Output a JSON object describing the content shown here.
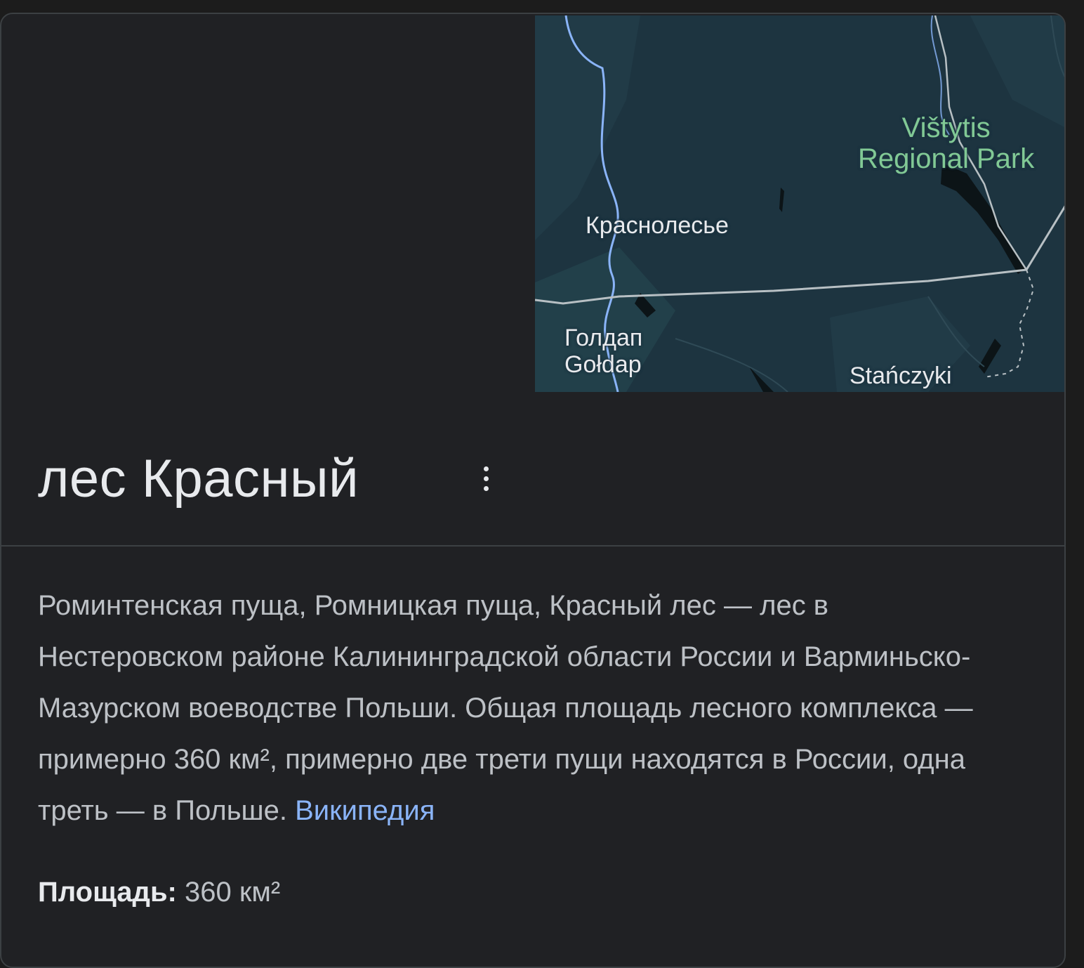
{
  "map": {
    "labels": {
      "krasnolesye": "Краснолесье",
      "goldap_ru": "Голдап",
      "goldap_pl": "Gołdap",
      "stanczyki": "Stańczyki",
      "vistytis_line1": "Vištytis",
      "vistytis_line2": "Regional Park"
    }
  },
  "entity": {
    "title": "лес Красный",
    "description": "Роминтенская пуща, Ромницкая пуща, Красный лес — лес в Нестеровском районе Калининградской области России и Варминьско-Мазурском воеводстве Польши. Общая площадь лесного комплекса — примерно 360 км², примерно две трети пущи находятся в России, одна треть — в Польше.",
    "source_link": "Википедия"
  },
  "facts": {
    "area_label": "Площадь:",
    "area_value": "360 км²"
  },
  "colors": {
    "card_background": "#202124",
    "map_background": "#1d3440",
    "link": "#8ab4f8",
    "park_label": "#81c995"
  }
}
